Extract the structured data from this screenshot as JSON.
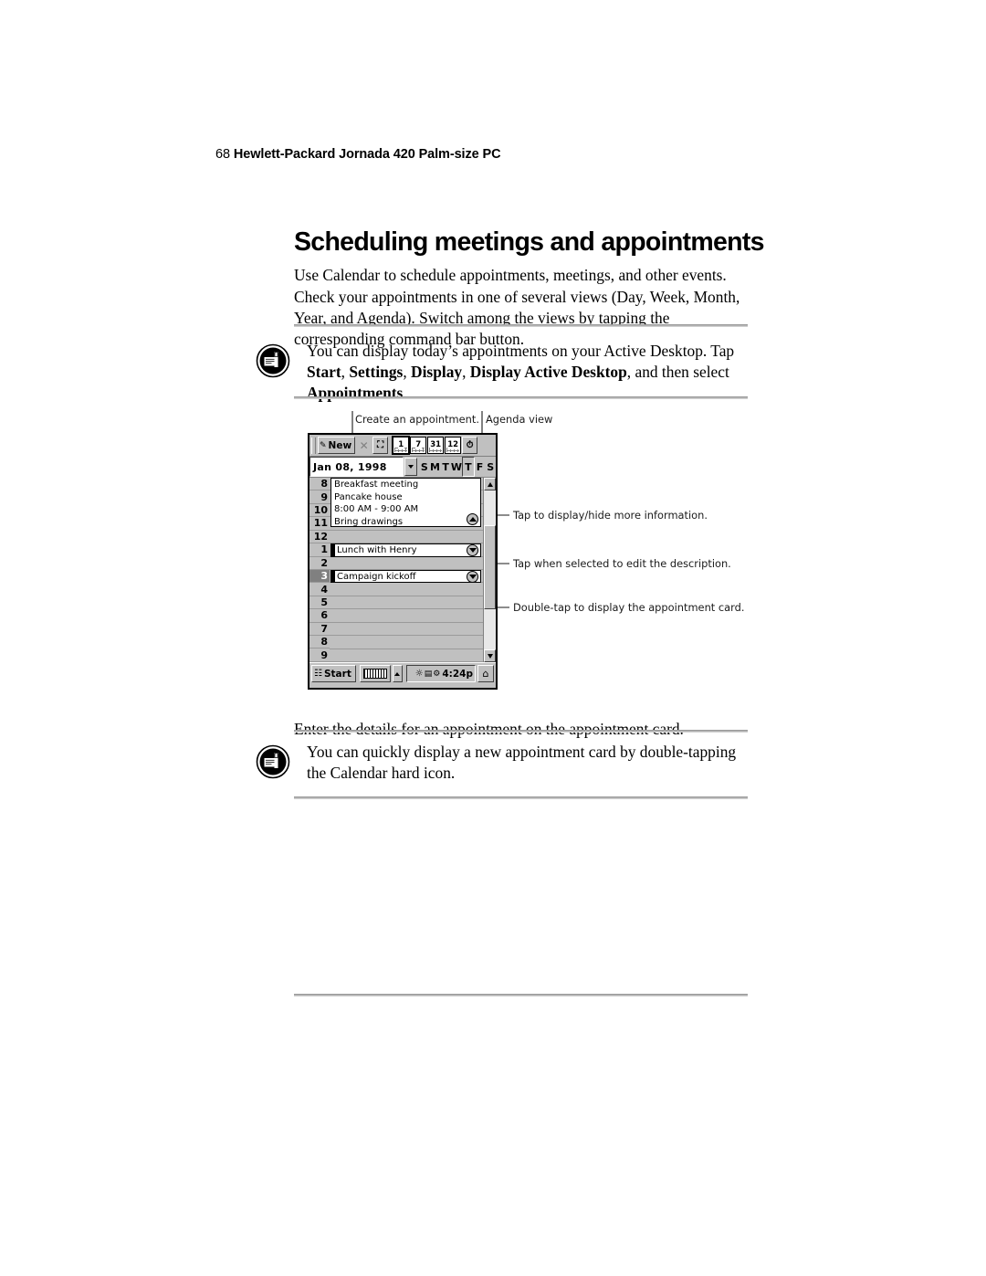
{
  "page": {
    "folio": "68",
    "running_head": "Hewlett-Packard Jornada 420 Palm-size PC",
    "section_title": "Scheduling meetings and appointments"
  },
  "intro": {
    "paragraph": "Use Calendar to schedule appointments, meetings, and other events. Check your appointments in one of several views (Day, Week, Month, Year, and Agenda). Switch among the views by tapping the corresponding command bar button."
  },
  "tips": [
    {
      "icon": "note-tip-icon",
      "line1_prefix": "You can display today’s appointments on your Active Desktop. Tap ",
      "bold1": "Start",
      "sep1": ", ",
      "bold2": "Settings",
      "sep2": ", ",
      "bold3": "Display",
      "sep3": ", ",
      "bold4": "Display Active Desktop",
      "sep4": ", and then select ",
      "bold5": "Appointments",
      "tail": "."
    },
    {
      "icon": "note-tip-icon",
      "text": "You can quickly display a new appointment card by double-tapping the Calendar hard icon."
    }
  ],
  "figure_caption": "Enter the details for an appointment on the appointment card.",
  "figure": {
    "callouts": {
      "create": "Create an appointment.",
      "agenda": "Agenda view",
      "display_hide": "Tap to display/hide more information.",
      "edit_description": "Tap when selected to edit the description.",
      "appointment_card": "Double-tap to display the appointment card."
    },
    "toolbar": {
      "new_label": "New",
      "new_icon": "new-appointment-icon",
      "delete_icon": "delete-x-icon",
      "beam_icon": "beam-icon",
      "views": [
        {
          "label": "1",
          "name": "day-view-button",
          "active": true
        },
        {
          "label": "7",
          "name": "week-view-button",
          "active": false
        },
        {
          "label": "31",
          "name": "month-view-button",
          "active": false
        },
        {
          "label": "12",
          "name": "year-view-button",
          "active": false
        }
      ],
      "agenda_icon": "agenda-view-icon"
    },
    "datebar": {
      "date": "Jan 08, 1998",
      "dropdown_icon": "chevron-down-icon",
      "days": [
        "S",
        "M",
        "T",
        "W",
        "T",
        "F",
        "S"
      ],
      "selected_day_index": 4
    },
    "hours": [
      "8",
      "9",
      "10",
      "11",
      "12",
      "1",
      "2",
      "3",
      "4",
      "5",
      "6",
      "7",
      "8",
      "9"
    ],
    "selected_hour_index": 7,
    "appointments": [
      {
        "name": "appointment-breakfast-meeting",
        "start_hour_index": 0,
        "lines": [
          "Breakfast meeting",
          "Pancake house",
          "8:00 AM - 9:00 AM",
          "Bring drawings"
        ],
        "expander": "collapse-chevron-up",
        "selected": false
      },
      {
        "name": "appointment-lunch-with-henry",
        "start_hour_index": 5,
        "lines": [
          "Lunch with Henry"
        ],
        "expander": "expand-chevron-down",
        "selected": true
      },
      {
        "name": "appointment-campaign-kickoff",
        "start_hour_index": 7,
        "lines": [
          "Campaign kickoff"
        ],
        "expander": "expand-chevron-down",
        "selected": true
      }
    ],
    "scrollbar": {
      "up_icon": "scroll-up-arrow",
      "down_icon": "scroll-down-arrow"
    },
    "taskbar": {
      "start_label": "Start",
      "start_icon": "windows-start-icon",
      "keyboard_icon": "soft-keyboard-icon",
      "up_icon": "chevron-up-icon",
      "tray_icons": [
        "volume-icon",
        "battery-icon",
        "connection-icon"
      ],
      "clock": "4:24p",
      "home_icon": "home-icon"
    }
  },
  "colors": {
    "rule_gray": "#9a9a9a",
    "chrome_gray": "#c0c0c0",
    "selection_gray": "#808080",
    "text_black": "#000000"
  }
}
